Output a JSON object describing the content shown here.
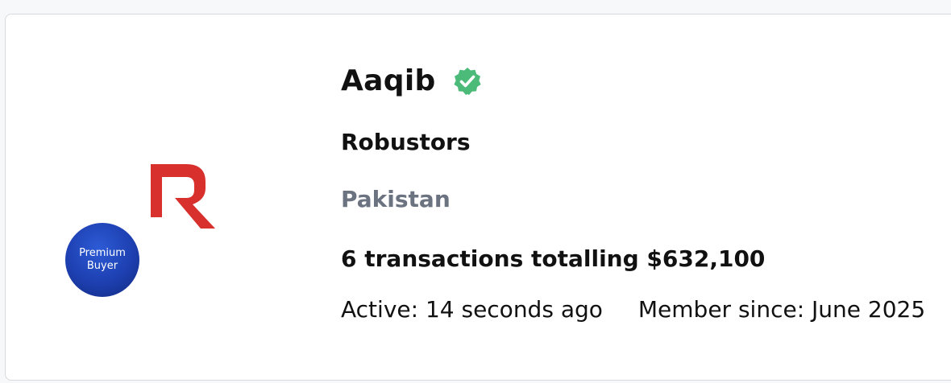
{
  "profile": {
    "name": "Aaqib",
    "verified_icon": "check-badge-icon",
    "company": "Robustors",
    "country": "Pakistan",
    "transactions": "6 transactions totalling $632,100",
    "active": "Active: 14 seconds ago",
    "member_since": "Member since: June 2025"
  },
  "badge": {
    "line1": "Premium",
    "line2": "Buyer"
  },
  "logo": {
    "icon": "robustors-r-logo",
    "color": "#d8302c"
  },
  "colors": {
    "verified": "#4cbb7a",
    "badge": "#1d3fb0",
    "muted_text": "#6b7280"
  }
}
